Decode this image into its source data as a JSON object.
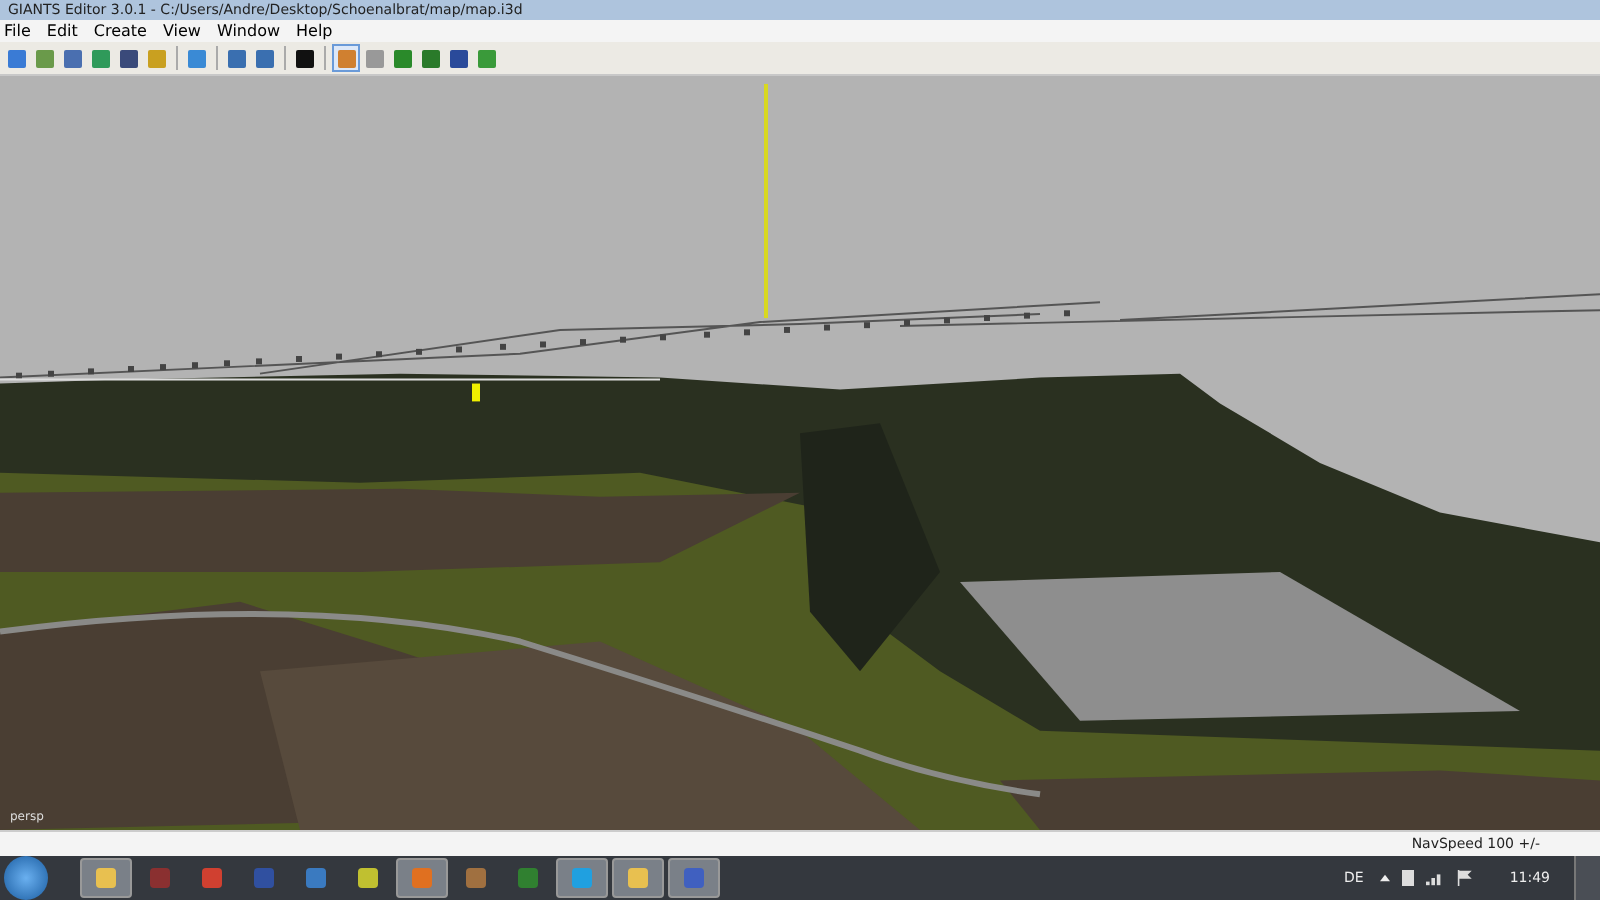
{
  "window": {
    "title": "GIANTS Editor 3.0.1 - C:/Users/Andre/Desktop/Schoenalbrat/map/map.i3d"
  },
  "menu": [
    "File",
    "Edit",
    "Create",
    "View",
    "Window",
    "Help"
  ],
  "viewport": {
    "camera_label": "persp"
  },
  "status_bar": {
    "nav_speed": "NavSpeed 100 +/-"
  },
  "taskbar": {
    "language": "DE",
    "clock": "11:49"
  }
}
